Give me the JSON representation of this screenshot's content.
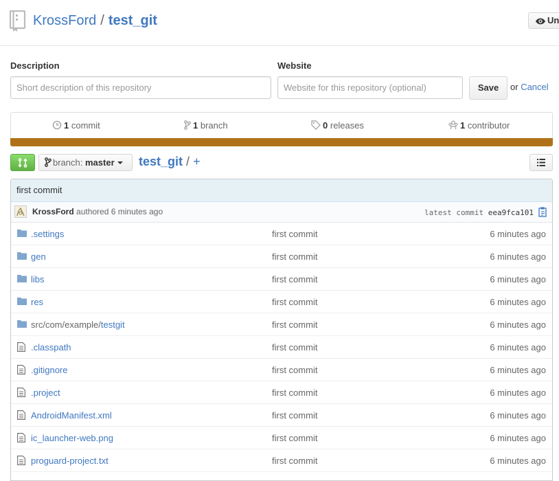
{
  "header": {
    "owner": "KrossFord",
    "separator": "/",
    "repo": "test_git",
    "watch_label": "Unwatch"
  },
  "details_form": {
    "description_label": "Description",
    "description_placeholder": "Short description of this repository",
    "website_label": "Website",
    "website_placeholder": "Website for this repository (optional)",
    "save_label": "Save",
    "or_text": "or",
    "cancel_label": "Cancel"
  },
  "summary": {
    "commits_count": "1",
    "commits_label": "commit",
    "branches_count": "1",
    "branches_label": "branch",
    "releases_count": "0",
    "releases_label": "releases",
    "contributors_count": "1",
    "contributors_label": "contributor"
  },
  "colors": {
    "language_bar": "#b07219",
    "link": "#4078c0",
    "compare_button": "#60b044"
  },
  "file_nav": {
    "branch_prefix": "branch:",
    "branch_name": "master",
    "breadcrumb_root": "test_git",
    "breadcrumb_sep": "/",
    "breadcrumb_add": "+"
  },
  "last_commit": {
    "message": "first commit",
    "author": "KrossFord",
    "action": "authored 6 minutes ago",
    "latest_label": "latest commit",
    "sha": "eea9fca101"
  },
  "files": [
    {
      "name": ".settings",
      "type": "dir",
      "message": "first commit",
      "age": "6 minutes ago"
    },
    {
      "name": "gen",
      "type": "dir",
      "message": "first commit",
      "age": "6 minutes ago"
    },
    {
      "name": "libs",
      "type": "dir",
      "message": "first commit",
      "age": "6 minutes ago"
    },
    {
      "name": "res",
      "type": "dir",
      "message": "first commit",
      "age": "6 minutes ago"
    },
    {
      "name_prefix": "src/com/example/",
      "name": "testgit",
      "type": "dir",
      "message": "first commit",
      "age": "6 minutes ago"
    },
    {
      "name": ".classpath",
      "type": "file",
      "message": "first commit",
      "age": "6 minutes ago"
    },
    {
      "name": ".gitignore",
      "type": "file",
      "message": "first commit",
      "age": "6 minutes ago"
    },
    {
      "name": ".project",
      "type": "file",
      "message": "first commit",
      "age": "6 minutes ago"
    },
    {
      "name": "AndroidManifest.xml",
      "type": "file",
      "message": "first commit",
      "age": "6 minutes ago"
    },
    {
      "name": "ic_launcher-web.png",
      "type": "file",
      "message": "first commit",
      "age": "6 minutes ago"
    },
    {
      "name": "proguard-project.txt",
      "type": "file",
      "message": "first commit",
      "age": "6 minutes ago"
    }
  ]
}
